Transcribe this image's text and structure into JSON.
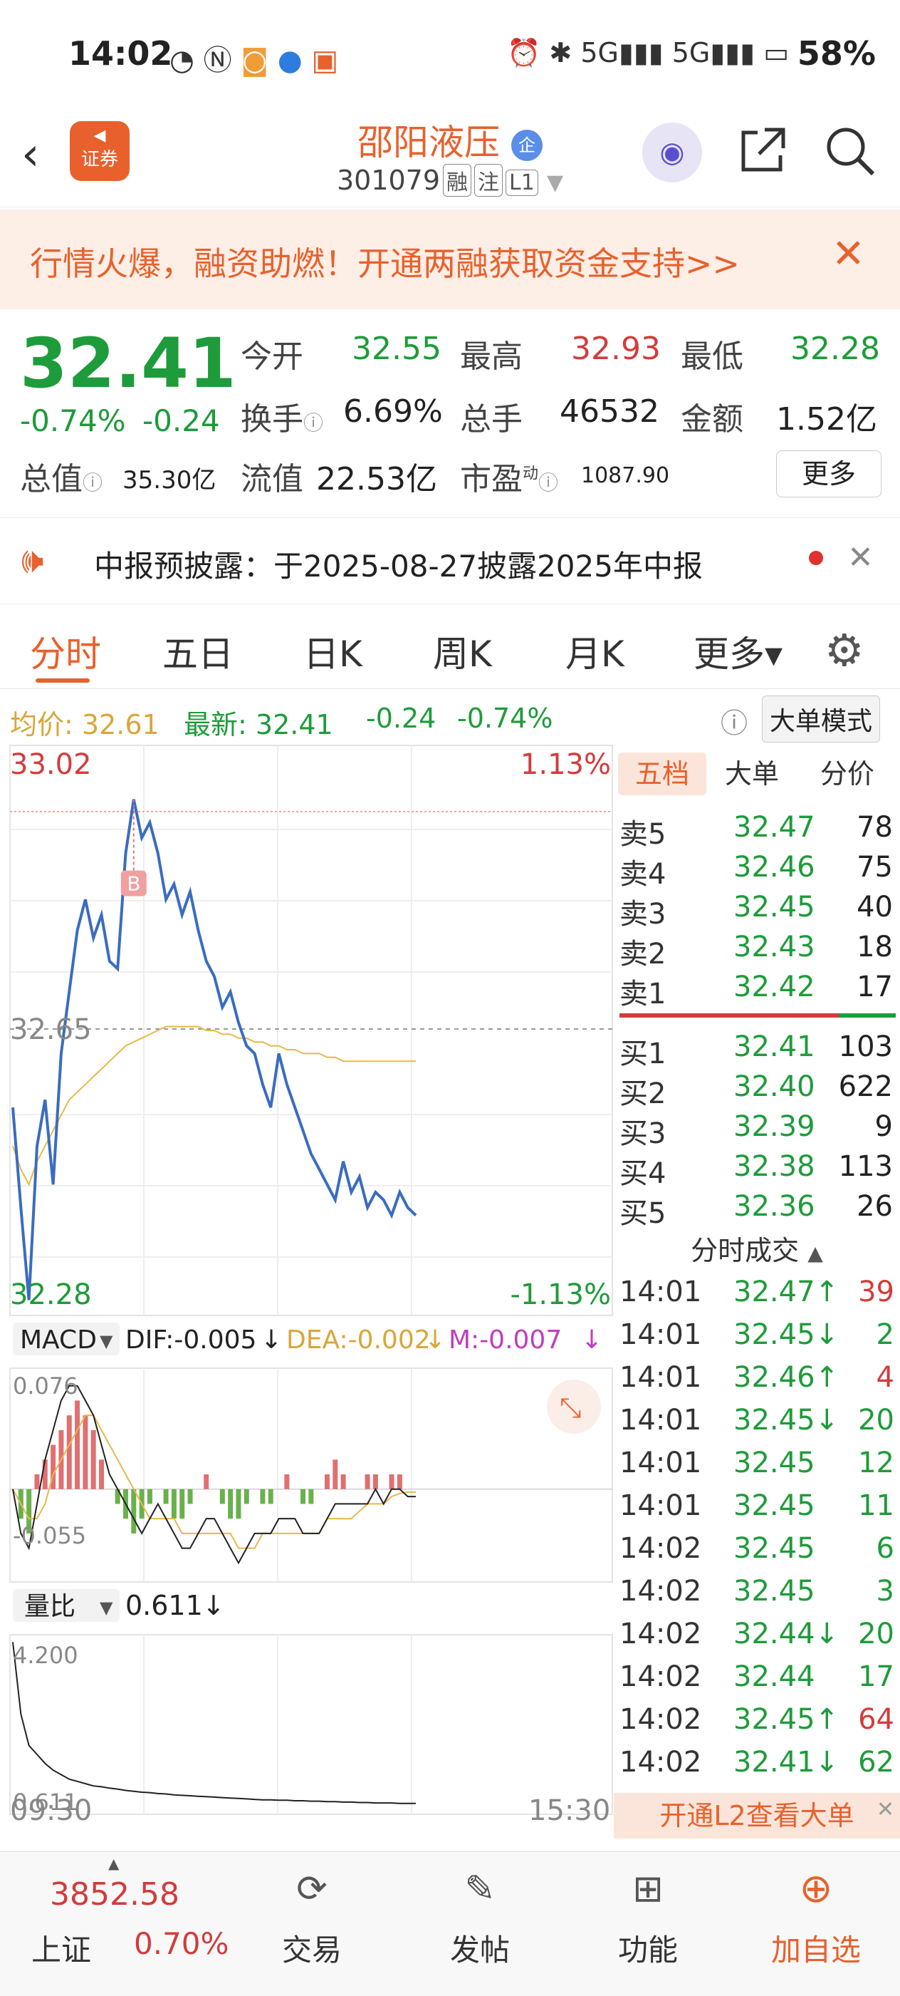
{
  "status_bar": {
    "time": "14:02",
    "battery": "58%",
    "network": "5G"
  },
  "header": {
    "back_icon": "chevron-left-icon",
    "brand_badge": "证券",
    "stock_name": "邵阳液压",
    "name_badge": "企",
    "stock_code": "301079",
    "tags": [
      "融",
      "注",
      "L1"
    ]
  },
  "banner": {
    "text": "行情火爆，融资助燃！开通两融获取资金支持>>"
  },
  "quote": {
    "price": "32.41",
    "change_pct": "-0.74%",
    "change": "-0.24",
    "open_label": "今开",
    "open": "32.55",
    "high_label": "最高",
    "high": "32.93",
    "low_label": "最低",
    "low": "32.28",
    "turnover_label": "换手",
    "turnover": "6.69%",
    "volume_label": "总手",
    "volume": "46532",
    "amount_label": "金额",
    "amount": "1.52亿",
    "mcap_label": "总值",
    "mcap": "35.30亿",
    "float_label": "流值",
    "float_cap": "22.53亿",
    "pe_label": "市盈",
    "pe_sup": "动",
    "pe": "1087.90",
    "more_button": "更多"
  },
  "notice": {
    "text": "中报预披露：于2025-08-27披露2025年中报"
  },
  "tabs": [
    "分时",
    "五日",
    "日K",
    "周K",
    "月K",
    "更多▾"
  ],
  "info_line": {
    "avg_label": "均价:",
    "avg": "32.61",
    "latest_label": "最新:",
    "latest": "32.41",
    "change": "-0.24",
    "change_pct": "-0.74%",
    "mode_button": "大单模式"
  },
  "chart_data": [
    {
      "type": "line",
      "title": "",
      "ylim": [
        32.28,
        33.02
      ],
      "y_ticks_left": [
        "33.02",
        "32.65",
        "32.28"
      ],
      "y_ticks_right": [
        "1.13%",
        "-1.13%"
      ],
      "x_ticks": [
        "09:30",
        "15:30"
      ],
      "marker": "B",
      "series": [
        {
          "name": "",
          "values": [
            32.55,
            32.42,
            32.3,
            32.5,
            32.56,
            32.45,
            32.62,
            32.7,
            32.78,
            32.82,
            32.77,
            32.8,
            32.74,
            32.73,
            32.88,
            32.95,
            32.9,
            32.92,
            32.88,
            32.82,
            32.84,
            32.8,
            32.83,
            32.78,
            32.74,
            32.72,
            32.68,
            32.7,
            32.66,
            32.63,
            32.62,
            32.58,
            32.55,
            32.62,
            32.58,
            32.55,
            32.52,
            32.49,
            32.47,
            32.45,
            32.43,
            32.48,
            32.44,
            32.46,
            32.42,
            32.44,
            32.43,
            32.41,
            32.44,
            32.42,
            32.41
          ]
        },
        {
          "name": "",
          "values": [
            32.5,
            32.47,
            32.45,
            32.48,
            32.5,
            32.52,
            32.54,
            32.56,
            32.57,
            32.58,
            32.59,
            32.6,
            32.61,
            32.62,
            32.63,
            32.635,
            32.64,
            32.645,
            32.65,
            32.655,
            32.655,
            32.655,
            32.655,
            32.655,
            32.65,
            32.65,
            32.645,
            32.645,
            32.64,
            32.64,
            32.635,
            32.635,
            32.63,
            32.63,
            32.625,
            32.625,
            32.62,
            32.62,
            32.62,
            32.615,
            32.615,
            32.61,
            32.61,
            32.61,
            32.61,
            32.61,
            32.61,
            32.61,
            32.61,
            32.61,
            32.61
          ]
        }
      ]
    },
    {
      "type": "bar",
      "title": "MACD",
      "dif": "DIF:-0.005",
      "dea": "DEA:-0.002",
      "m": "M:-0.007",
      "ylim": [
        -0.055,
        0.076
      ],
      "y_ticks": [
        "0.076",
        "-0.055"
      ],
      "values": [
        0.0,
        -0.02,
        -0.03,
        0.01,
        0.02,
        0.03,
        0.04,
        0.05,
        0.06,
        0.05,
        0.04,
        0.02,
        0.0,
        -0.01,
        -0.02,
        -0.03,
        -0.02,
        -0.01,
        0.0,
        -0.01,
        -0.02,
        -0.02,
        -0.01,
        0.0,
        0.01,
        0.0,
        -0.01,
        -0.02,
        -0.02,
        -0.01,
        0.0,
        -0.01,
        -0.01,
        0.0,
        0.01,
        0.0,
        -0.01,
        -0.01,
        0.0,
        0.01,
        0.02,
        0.01,
        0.0,
        0.0,
        0.01,
        0.01,
        0.0,
        0.01,
        0.01,
        0.0,
        0.0
      ],
      "series": [
        {
          "name": "DIF",
          "values": [
            0.0,
            -0.03,
            -0.04,
            -0.01,
            0.02,
            0.04,
            0.06,
            0.07,
            0.07,
            0.06,
            0.05,
            0.03,
            0.01,
            0.0,
            -0.01,
            -0.02,
            -0.03,
            -0.02,
            -0.01,
            -0.02,
            -0.03,
            -0.04,
            -0.04,
            -0.03,
            -0.02,
            -0.02,
            -0.03,
            -0.04,
            -0.05,
            -0.04,
            -0.03,
            -0.03,
            -0.03,
            -0.02,
            -0.02,
            -0.02,
            -0.03,
            -0.03,
            -0.03,
            -0.02,
            -0.01,
            -0.01,
            -0.01,
            -0.01,
            -0.01,
            0.0,
            -0.01,
            0.0,
            0.0,
            -0.005,
            -0.005
          ]
        },
        {
          "name": "DEA",
          "values": [
            0.0,
            -0.01,
            -0.02,
            -0.02,
            -0.01,
            0.01,
            0.02,
            0.03,
            0.04,
            0.05,
            0.05,
            0.04,
            0.03,
            0.02,
            0.01,
            0.0,
            -0.01,
            -0.02,
            -0.02,
            -0.02,
            -0.02,
            -0.03,
            -0.03,
            -0.03,
            -0.03,
            -0.03,
            -0.03,
            -0.03,
            -0.04,
            -0.04,
            -0.04,
            -0.03,
            -0.03,
            -0.03,
            -0.03,
            -0.03,
            -0.03,
            -0.03,
            -0.03,
            -0.02,
            -0.02,
            -0.02,
            -0.02,
            -0.015,
            -0.01,
            -0.01,
            -0.01,
            -0.005,
            -0.003,
            -0.002,
            -0.002
          ]
        }
      ]
    },
    {
      "type": "line",
      "title": "量比",
      "value_label": "0.611",
      "ylim": [
        0.611,
        4.2
      ],
      "y_ticks": [
        "4.200",
        "0.611"
      ],
      "series": [
        {
          "name": "",
          "values": [
            4.2,
            2.6,
            1.9,
            1.7,
            1.5,
            1.35,
            1.25,
            1.15,
            1.1,
            1.05,
            1.0,
            0.98,
            0.95,
            0.93,
            0.9,
            0.88,
            0.86,
            0.85,
            0.83,
            0.82,
            0.8,
            0.79,
            0.78,
            0.77,
            0.76,
            0.75,
            0.74,
            0.73,
            0.72,
            0.71,
            0.7,
            0.69,
            0.69,
            0.68,
            0.68,
            0.67,
            0.67,
            0.66,
            0.66,
            0.65,
            0.65,
            0.64,
            0.64,
            0.63,
            0.63,
            0.62,
            0.62,
            0.62,
            0.61,
            0.611,
            0.611
          ]
        }
      ]
    }
  ],
  "order_book": {
    "tabs": [
      "五档",
      "大单",
      "分价"
    ],
    "asks": [
      {
        "label": "卖5",
        "price": "32.47",
        "vol": "78"
      },
      {
        "label": "卖4",
        "price": "32.46",
        "vol": "75"
      },
      {
        "label": "卖3",
        "price": "32.45",
        "vol": "40"
      },
      {
        "label": "卖2",
        "price": "32.43",
        "vol": "18"
      },
      {
        "label": "卖1",
        "price": "32.42",
        "vol": "17"
      }
    ],
    "bids": [
      {
        "label": "买1",
        "price": "32.41",
        "vol": "103"
      },
      {
        "label": "买2",
        "price": "32.40",
        "vol": "622"
      },
      {
        "label": "买3",
        "price": "32.39",
        "vol": "9"
      },
      {
        "label": "买4",
        "price": "32.38",
        "vol": "113"
      },
      {
        "label": "买5",
        "price": "32.36",
        "vol": "26"
      }
    ],
    "trades_title": "分时成交",
    "trades": [
      {
        "time": "14:01",
        "price": "32.47↑",
        "vol": "39",
        "dir": "up"
      },
      {
        "time": "14:01",
        "price": "32.45↓",
        "vol": "2",
        "dir": "down"
      },
      {
        "time": "14:01",
        "price": "32.46↑",
        "vol": "4",
        "dir": "up"
      },
      {
        "time": "14:01",
        "price": "32.45↓",
        "vol": "20",
        "dir": "down"
      },
      {
        "time": "14:01",
        "price": "32.45",
        "vol": "12",
        "dir": "down"
      },
      {
        "time": "14:01",
        "price": "32.45",
        "vol": "11",
        "dir": "down"
      },
      {
        "time": "14:02",
        "price": "32.45",
        "vol": "6",
        "dir": "down"
      },
      {
        "time": "14:02",
        "price": "32.45",
        "vol": "3",
        "dir": "down"
      },
      {
        "time": "14:02",
        "price": "32.44↓",
        "vol": "20",
        "dir": "down"
      },
      {
        "time": "14:02",
        "price": "32.44",
        "vol": "17",
        "dir": "down"
      },
      {
        "time": "14:02",
        "price": "32.45↑",
        "vol": "64",
        "dir": "up"
      },
      {
        "time": "14:02",
        "price": "32.41↓",
        "vol": "62",
        "dir": "down"
      }
    ],
    "l2_button": "开通L2查看大单"
  },
  "bottom_bar": {
    "index_value": "3852.58",
    "index_name": "上证",
    "index_change": "0.70%",
    "items": [
      "交易",
      "发帖",
      "功能",
      "加自选"
    ]
  },
  "colors": {
    "accent": "#e8612c",
    "up": "#d33b3b",
    "down": "#1e9b3a",
    "price_line": "#3a6cc0",
    "avg_line": "#e8b84a"
  }
}
